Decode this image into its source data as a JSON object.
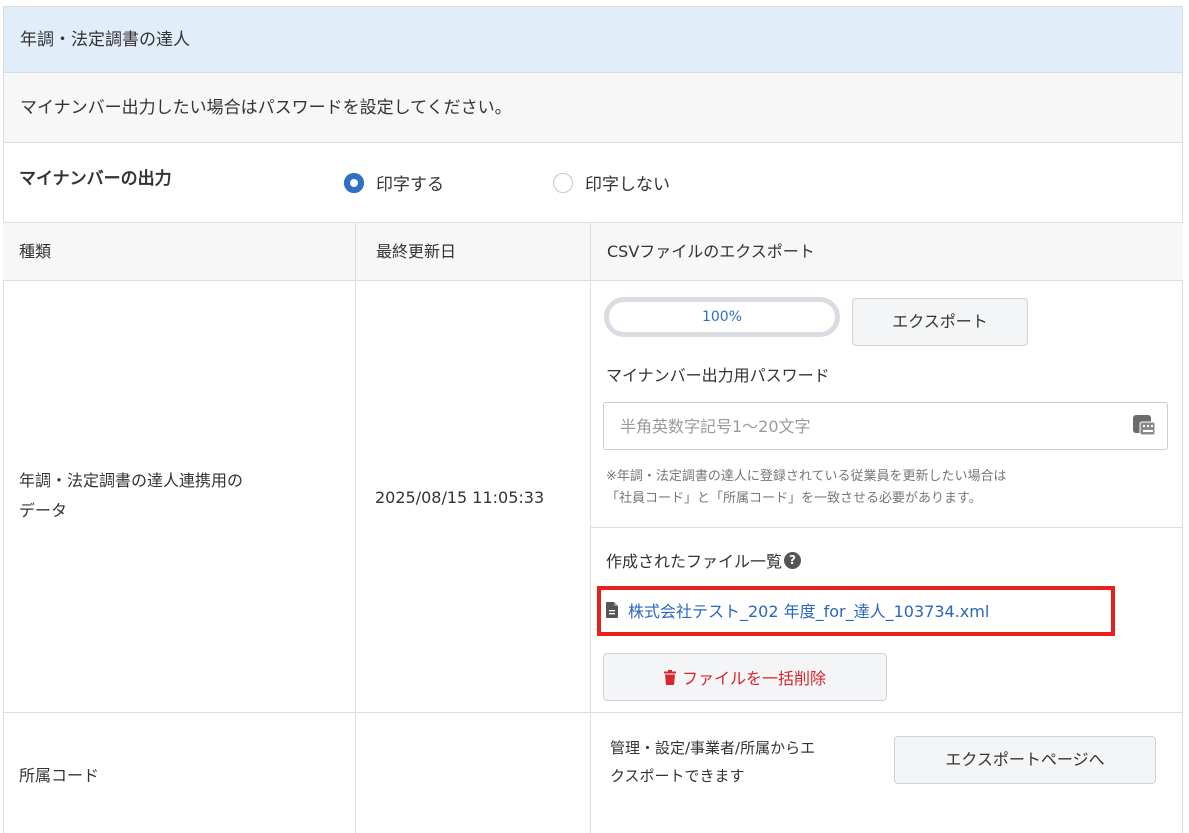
{
  "header": {
    "title": "年調・法定調書の達人"
  },
  "notice": {
    "text": "マイナンバー出力したい場合はパスワードを設定してください。"
  },
  "mynumber_output": {
    "label": "マイナンバーの出力",
    "options": [
      {
        "label": "印字する",
        "selected": true
      },
      {
        "label": "印字しない",
        "selected": false
      }
    ]
  },
  "table": {
    "headers": [
      "種類",
      "最終更新日",
      "CSVファイルのエクスポート"
    ],
    "rows": [
      {
        "type_lines": [
          "年調・法定調書の達人連携用の",
          "データ"
        ],
        "updated": "2025/08/15 11:05:33",
        "export": {
          "progress_label": "100%",
          "progress_percent": 100,
          "export_button": "エクスポート",
          "password_label": "マイナンバー出力用パスワード",
          "password_placeholder": "半角英数字記号1〜20文字",
          "note_lines": [
            "※年調・法定調書の達人に登録されている従業員を更新したい場合は",
            "「社員コード」と「所属コード」を一致させる必要があります。"
          ],
          "files_title": "作成されたファイル一覧",
          "files": [
            {
              "name": "株式会社テスト_202 年度_for_達人_103734.xml"
            }
          ],
          "delete_all_button": "ファイルを一括削除"
        }
      },
      {
        "type_lines": [
          "所属コード"
        ],
        "updated": "",
        "export": {
          "note_lines": [
            "管理・設定/事業者/所属からエ",
            "クスポートできます"
          ],
          "export_page_button": "エクスポートページへ"
        }
      }
    ]
  },
  "colors": {
    "accent": "#2f6fc4",
    "link": "#2a66c0",
    "danger": "#d8262e",
    "highlight": "#e8201e",
    "header_bg": "#e1edf8"
  }
}
